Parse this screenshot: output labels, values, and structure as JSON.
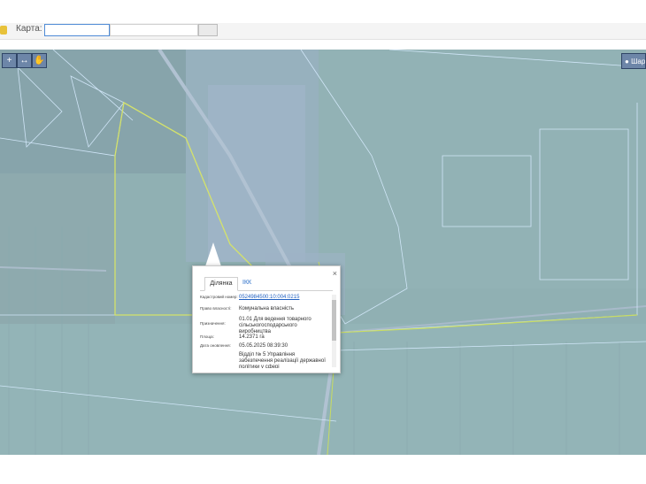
{
  "header": {
    "map_label": "Карта:"
  },
  "map": {
    "layers_button_label": "Шари",
    "controls": [
      {
        "name": "zoom-control",
        "glyph": "+"
      },
      {
        "name": "measure-control",
        "glyph": "↔"
      },
      {
        "name": "hand-control",
        "glyph": "✋"
      }
    ]
  },
  "popup": {
    "close_glyph": "×",
    "tabs": [
      "Ділянка",
      "ІКК"
    ],
    "fields": [
      {
        "label": "Кадастровий номер:",
        "value": "0524984500:10:004:0215"
      },
      {
        "label": "Право власності:",
        "value": "Комунальна власність"
      },
      {
        "label": "Призначення:",
        "value": "01.01 Для ведення товарного сільськогосподарського виробництва"
      },
      {
        "label": "Площа:",
        "value": "14.2371 га"
      },
      {
        "label": "Дата оновлення:",
        "value": "05.05.2025 08:39:30"
      },
      {
        "label": "",
        "value": "Відділ № 5 Управління забезпечення реалізації державної політики у сфері"
      }
    ]
  }
}
